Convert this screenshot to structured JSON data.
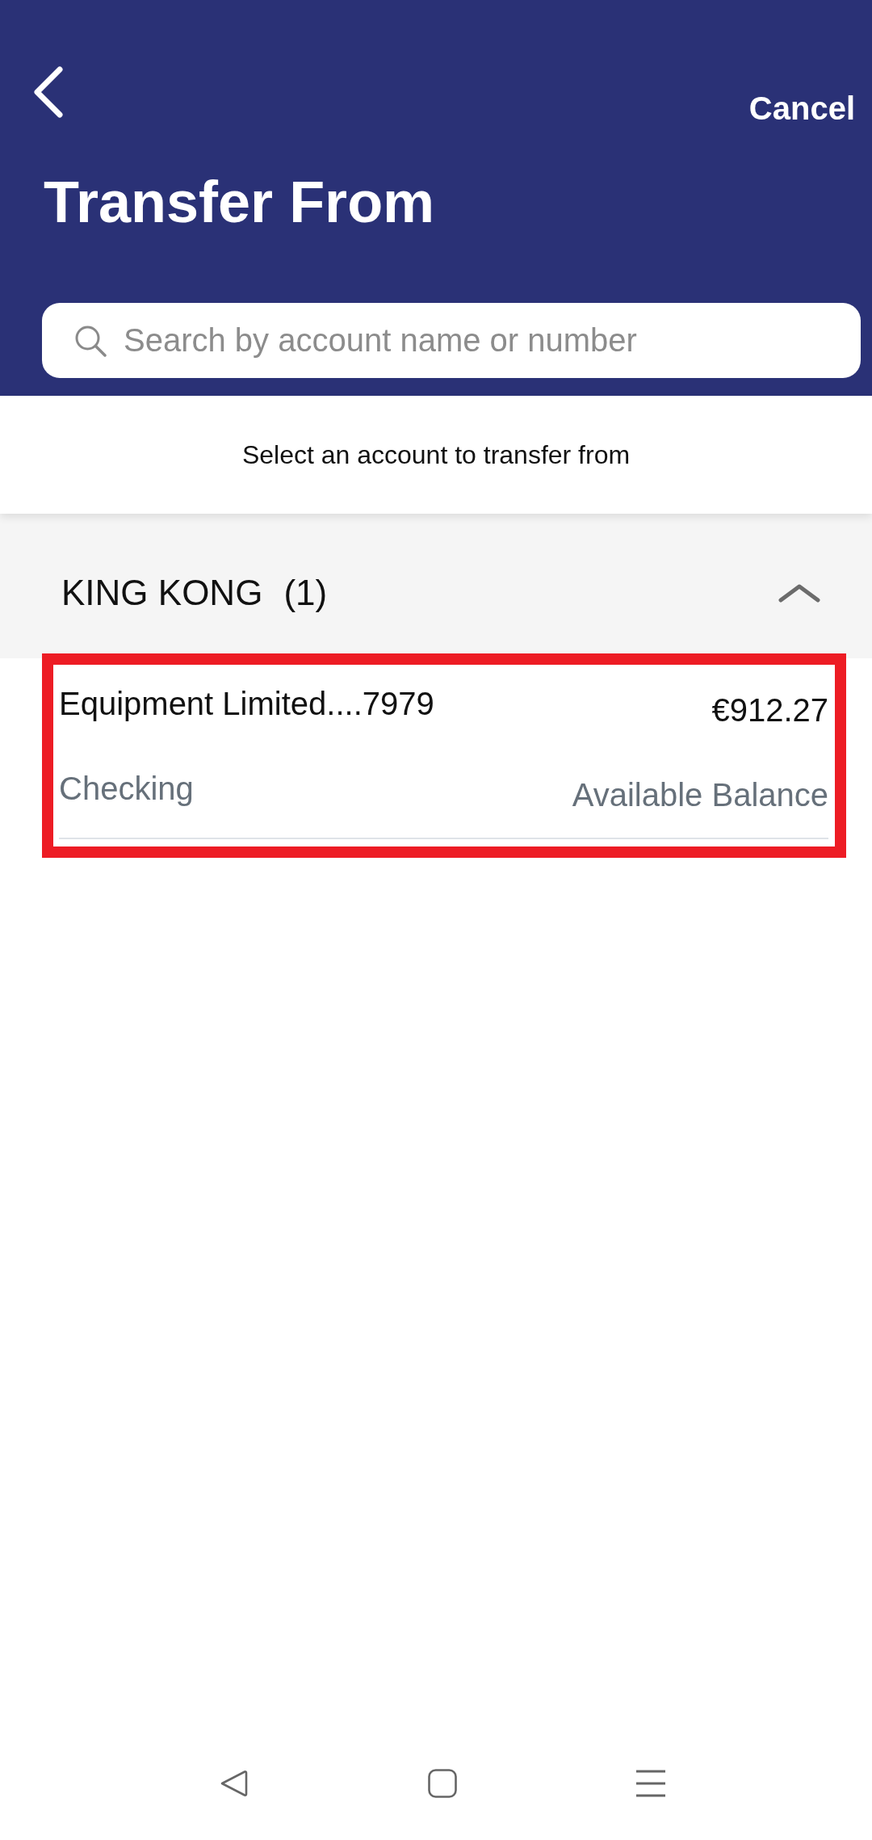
{
  "header": {
    "cancel": "Cancel",
    "title": "Transfer From"
  },
  "search": {
    "placeholder": "Search by account name or number"
  },
  "instruction": "Select an account to transfer from",
  "groups": [
    {
      "name": "KING KONG",
      "count": "(1)",
      "expanded": true,
      "accounts": [
        {
          "name": "Equipment Limited....7979",
          "balance": "€912.27",
          "type": "Checking",
          "balance_label": "Available Balance",
          "highlighted": true
        }
      ]
    }
  ]
}
